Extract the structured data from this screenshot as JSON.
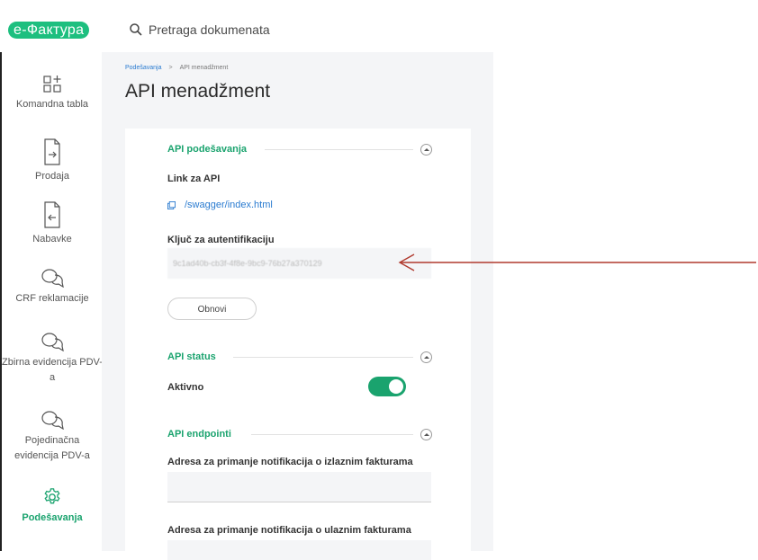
{
  "app": {
    "logo": "е-Фактура"
  },
  "search": {
    "placeholder": "Pretraga dokumenata",
    "icon": "search-icon"
  },
  "sidebar": {
    "items": [
      {
        "label": "Komandna tabla",
        "icon": "dashboard-icon",
        "active": false
      },
      {
        "label": "Prodaja",
        "icon": "document-out-icon",
        "active": false
      },
      {
        "label": "Nabavke",
        "icon": "document-in-icon",
        "active": false
      },
      {
        "label": "CRF reklamacije",
        "icon": "chat-icon",
        "active": false
      },
      {
        "label": "Zbirna evidencija PDV-a",
        "icon": "chat-icon",
        "active": false
      },
      {
        "label": "Pojedinačna evidencija PDV-a",
        "icon": "chat-icon",
        "active": false
      },
      {
        "label": "Podešavanja",
        "icon": "gear-icon",
        "active": true
      }
    ]
  },
  "breadcrumb": {
    "parent": "Podešavanja",
    "separator": ">",
    "current": "API menadžment"
  },
  "page": {
    "title": "API menadžment"
  },
  "api_settings": {
    "title": "API podešavanja",
    "link_label": "Link za API",
    "link_text": "/swagger/index.html",
    "key_label": "Ključ za autentifikaciju",
    "key_value": "9c1ad40b-cb3f-4f8e-9bc9-76b27a370129",
    "renew_button": "Obnovi"
  },
  "api_status": {
    "title": "API status",
    "label": "Aktivno",
    "enabled": true
  },
  "api_endpoints": {
    "title": "API endpointi",
    "outgoing_label": "Adresa za primanje notifikacija o izlaznim fakturama",
    "incoming_label": "Adresa za primanje notifikacija o ulaznim fakturama"
  },
  "colors": {
    "accent": "#1aa36e",
    "link": "#2a7bd0",
    "arrow": "#b03a2e"
  }
}
